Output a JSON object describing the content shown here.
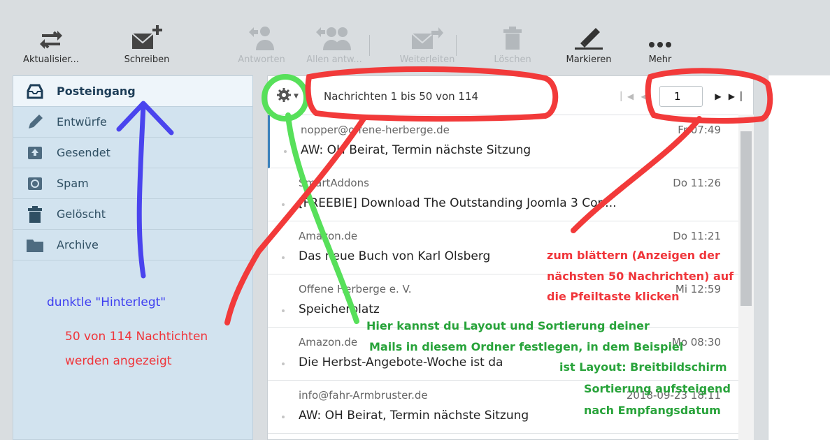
{
  "toolbar": {
    "buttons": [
      {
        "label": "Aktualisier...",
        "icon": "refresh-icon"
      },
      {
        "label": "Schreiben",
        "icon": "compose-icon"
      },
      {
        "label": "Antworten",
        "icon": "reply-icon"
      },
      {
        "label": "Allen antw...",
        "icon": "reply-all-icon"
      },
      {
        "label": "Weiterleiten",
        "icon": "forward-icon"
      },
      {
        "label": "Löschen",
        "icon": "trash-icon"
      },
      {
        "label": "Markieren",
        "icon": "pen-icon"
      },
      {
        "label": "Mehr",
        "icon": "more-icon"
      }
    ]
  },
  "folders": [
    {
      "label": "Posteingang",
      "icon": "inbox-icon",
      "active": true
    },
    {
      "label": "Entwürfe",
      "icon": "pencil-icon"
    },
    {
      "label": "Gesendet",
      "icon": "sent-icon"
    },
    {
      "label": "Spam",
      "icon": "spam-icon"
    },
    {
      "label": "Gelöscht",
      "icon": "trash-icon"
    },
    {
      "label": "Archive",
      "icon": "archive-folder-icon"
    }
  ],
  "list": {
    "count_text": "Nachrichten 1 bis 50 von 114",
    "page": "1",
    "messages": [
      {
        "from": "nopper@offene-herberge.de",
        "date": "Fr 07:49",
        "subject": "AW: OH Beirat, Termin nächste Sitzung"
      },
      {
        "from": "SmartAddons",
        "date": "Do 11:26",
        "subject": "[FREEBIE] Download The Outstanding Joomla 3 Con..."
      },
      {
        "from": "Amazon.de",
        "date": "Do 11:21",
        "subject": "Das neue Buch von Karl Olsberg"
      },
      {
        "from": "Offene Herberge e. V.",
        "date": "Mi 12:59",
        "subject": "Speicherplatz"
      },
      {
        "from": "Amazon.de",
        "date": "Mo 08:30",
        "subject": "Die Herbst-Angebote-Woche ist da"
      },
      {
        "from": "info@fahr-Armbruster.de",
        "date": "2018-09-23 18:11",
        "subject": "AW: OH Beirat, Termin nächste Sitzung"
      }
    ]
  },
  "annotations": {
    "blue": "dunktle \"Hinterlegt\"",
    "red_left_1": "50 von 114 Nachtichten",
    "red_left_2": "werden angezeigt",
    "red_right_1": "zum blättern (Anzeigen der",
    "red_right_2": "nächsten 50 Nachrichten) auf",
    "red_right_3": "die Pfeiltaste klicken",
    "green_1": "Hier kannst du Layout und Sortierung deiner",
    "green_2": "Mails in diesem Ordner festlegen, in dem Beispiel",
    "green_3": "ist Layout: Breitbildschirm",
    "green_4": "Sortierung aufsteigend",
    "green_5": "nach Empfangsdatum"
  },
  "colors": {
    "annotation_blue": "#3d3df0",
    "annotation_red": "#f0353a",
    "annotation_green": "#28a33a",
    "selected_border": "#3c82bc"
  }
}
